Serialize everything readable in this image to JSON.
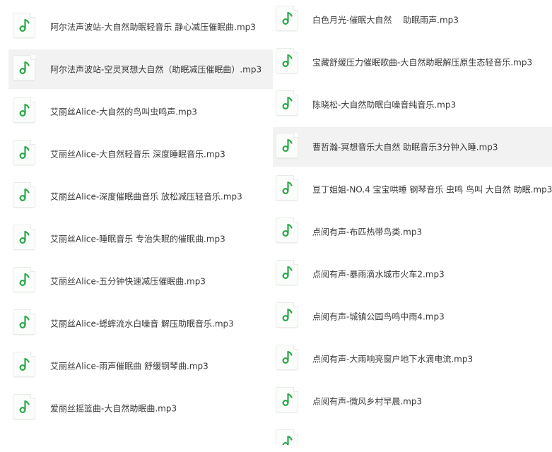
{
  "left_files": [
    {
      "name": "阿尔法声波站-大自然助眠轻音乐 静心减压催眠曲.mp3",
      "icon": "music-note-icon"
    },
    {
      "name": "阿尔法声波站-空灵冥想大自然（助眠减压催眠曲）.mp3",
      "icon": "music-note-icon",
      "selected": true
    },
    {
      "name": "艾丽丝Alice-大自然的鸟叫虫鸣声.mp3",
      "icon": "music-note-icon"
    },
    {
      "name": "艾丽丝Alice-大自然轻音乐 深度睡眠音乐.mp3",
      "icon": "music-note-icon"
    },
    {
      "name": "艾丽丝Alice-深度催眠曲音乐 放松减压轻音乐.mp3",
      "icon": "music-note-icon"
    },
    {
      "name": "艾丽丝Alice-睡眠音乐 专治失眠的催眠曲.mp3",
      "icon": "music-note-icon"
    },
    {
      "name": "艾丽丝Alice-五分钟快速减压催眠曲.mp3",
      "icon": "music-note-icon"
    },
    {
      "name": "艾丽丝Alice-蟋蟀流水白噪音 解压助眠音乐.mp3",
      "icon": "music-note-icon"
    },
    {
      "name": "艾丽丝Alice-雨声催眠曲 舒缓钢琴曲.mp3",
      "icon": "music-note-icon"
    },
    {
      "name": "爱丽丝摇篮曲-大自然助眠曲.mp3",
      "icon": "music-note-icon"
    }
  ],
  "right_files": [
    {
      "name": "白色月光-催眠大自然　 助眠雨声.mp3",
      "icon": "music-note-icon"
    },
    {
      "name": "宝藏舒缓压力催眠歌曲-大自然助眠解压原生态轻音乐.mp3",
      "icon": "music-note-icon"
    },
    {
      "name": "陈晓松-大自然助眠白噪音纯音乐.mp3",
      "icon": "music-note-icon"
    },
    {
      "name": "曹哲瀚-冥想音乐大自然 助眠音乐3分钟入睡.mp3",
      "icon": "music-note-icon",
      "selected": true
    },
    {
      "name": "豆丁姐姐-NO.4 宝宝哄睡 钢琴音乐 虫鸣 鸟叫 大自然 助眠.mp3",
      "icon": "music-note-icon"
    },
    {
      "name": "点阅有声-布匹热带鸟类.mp3",
      "icon": "music-note-icon"
    },
    {
      "name": "点阅有声-暴雨滴水城市火车2.mp3",
      "icon": "music-note-icon"
    },
    {
      "name": "点阅有声-城镇公园鸟鸣中雨4.mp3",
      "icon": "music-note-icon"
    },
    {
      "name": "点阅有声-大雨响亮窗户地下水滴电流.mp3",
      "icon": "music-note-icon"
    },
    {
      "name": "点阅有声-微风乡村早晨.mp3",
      "icon": "music-note-icon"
    }
  ],
  "colors": {
    "icon_green": "#2aa84a",
    "selected_bg": "#f2f2f2",
    "text": "#3a3a3a"
  }
}
